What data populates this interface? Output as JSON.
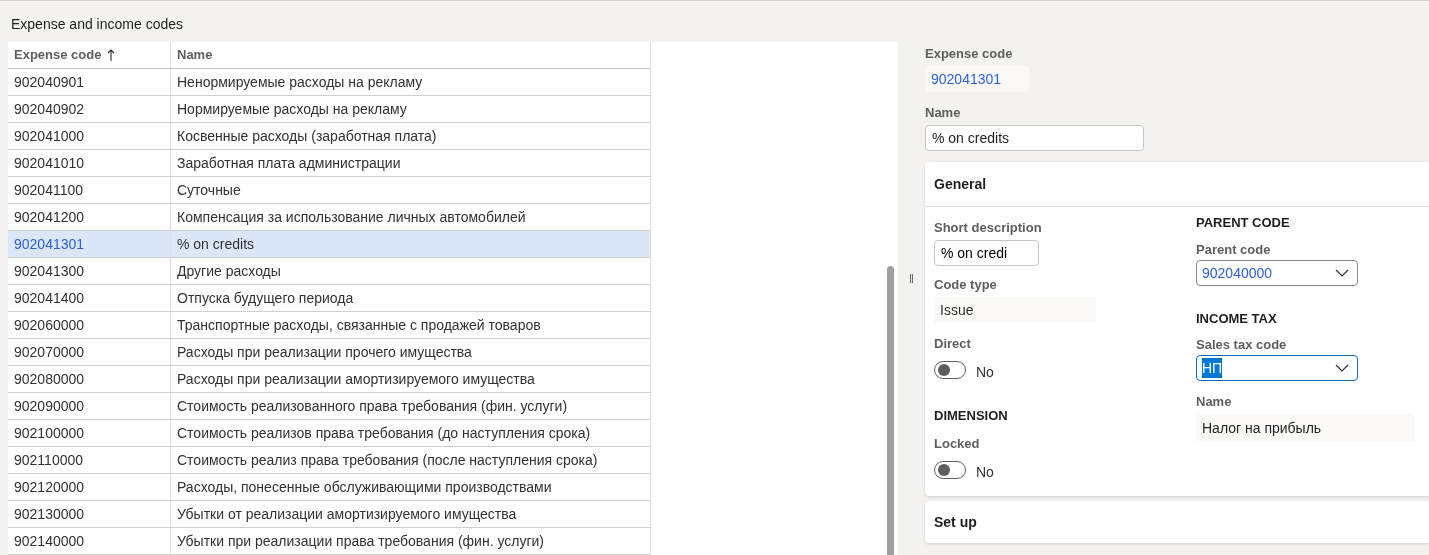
{
  "page_title": "Expense and income codes",
  "table": {
    "columns": [
      {
        "label": "Expense code",
        "sorted_ascending": true
      },
      {
        "label": "Name"
      }
    ],
    "rows": [
      {
        "code": "902040901",
        "name": "Ненормируемые расходы на рекламу",
        "selected": false
      },
      {
        "code": "902040902",
        "name": "Нормируемые расходы на рекламу",
        "selected": false
      },
      {
        "code": "902041000",
        "name": "Косвенные расходы (заработная плата)",
        "selected": false
      },
      {
        "code": "902041010",
        "name": "Заработная плата администрации",
        "selected": false
      },
      {
        "code": "902041100",
        "name": "Суточные",
        "selected": false
      },
      {
        "code": "902041200",
        "name": "Компенсация за использование личных автомобилей",
        "selected": false
      },
      {
        "code": "902041301",
        "name": "% on credits",
        "selected": true
      },
      {
        "code": "902041300",
        "name": "Другие расходы",
        "selected": false
      },
      {
        "code": "902041400",
        "name": "Отпуска будущего периода",
        "selected": false
      },
      {
        "code": "902060000",
        "name": "Транспортные расходы, связанные с продажей товаров",
        "selected": false
      },
      {
        "code": "902070000",
        "name": "Расходы при реализации прочего имущества",
        "selected": false
      },
      {
        "code": "902080000",
        "name": "Расходы при реализации амортизируемого имущества",
        "selected": false
      },
      {
        "code": "902090000",
        "name": "Стоимость реализованного права требования (фин. услуги)",
        "selected": false
      },
      {
        "code": "902100000",
        "name": "Стоимость реализов права требования (до наступления срока)",
        "selected": false
      },
      {
        "code": "902110000",
        "name": "Стоимость реализ права требования (после наступления срока)",
        "selected": false
      },
      {
        "code": "902120000",
        "name": "Расходы, понесенные обслуживающими производствами",
        "selected": false
      },
      {
        "code": "902130000",
        "name": "Убытки от реализации амортизируемого имущества",
        "selected": false
      },
      {
        "code": "902140000",
        "name": "Убытки при реализации права требования (фин. услуги)",
        "selected": false
      }
    ]
  },
  "splitter": "‖",
  "details": {
    "expense_code": {
      "label": "Expense code",
      "value": "902041301"
    },
    "name": {
      "label": "Name",
      "value": "% on credits"
    },
    "general": {
      "title": "General",
      "expanded": true,
      "short_description": {
        "label": "Short description",
        "value": "% on credi"
      },
      "code_type": {
        "label": "Code type",
        "value": "Issue"
      },
      "direct": {
        "label": "Direct",
        "on": false,
        "text": "No"
      },
      "dimension_heading": "DIMENSION",
      "locked": {
        "label": "Locked",
        "on": false,
        "text": "No"
      },
      "parent_heading": "PARENT CODE",
      "parent_code": {
        "label": "Parent code",
        "value": "902040000",
        "focused": false
      },
      "income_tax_heading": "INCOME TAX",
      "sales_tax_code": {
        "label": "Sales tax code",
        "value": "НП",
        "focused": true
      },
      "tax_name": {
        "label": "Name",
        "value": "Налог на прибыль"
      }
    },
    "setup": {
      "title": "Set up",
      "expanded": false
    }
  }
}
